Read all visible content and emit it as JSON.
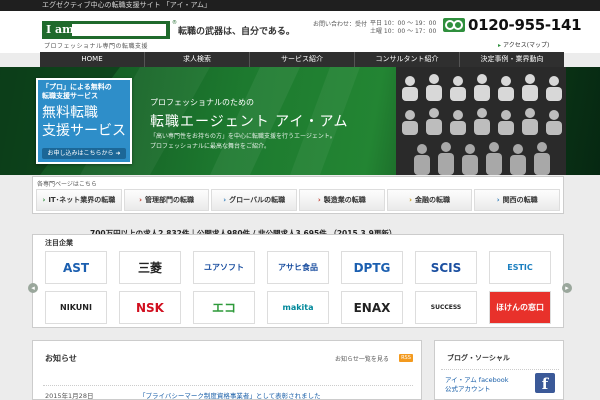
{
  "topbar": {
    "text": "エグゼクティブ中心の転職支援サイト 「アイ・アム」"
  },
  "header": {
    "logo_text": "I am",
    "logo_sub": "プロフェッショナル専門の転職支援",
    "tagline": "転職の武器は、自分である。",
    "contact_label": "お問い合わせ：受付",
    "hours_weekday": "平日 10：00 〜 19：00",
    "hours_saturday": "土曜 10：00 〜 17：00",
    "free_label": "0",
    "phone": "0120-955-141",
    "access": "アクセス(マップ)"
  },
  "nav": [
    "HOME",
    "求人検索",
    "サービス紹介",
    "コンサルタント紹介",
    "決定事例・業界動向"
  ],
  "hero": {
    "subtitle": "プロフェッショナルのための",
    "title": "転職エージェント アイ・アム",
    "desc1": "「高い専門性をお持ちの方」を中心に転職支援を行うエージェント。",
    "desc2": "プロフェッショナルに最高な舞台をご紹介。"
  },
  "promo": {
    "line1": "「プロ」による無料の",
    "line2": "転職支援サービス",
    "big1": "無料転職",
    "big2": "支援サービス",
    "button": "お申し込みはこちらから"
  },
  "specialty": {
    "label": "各専門ページはこちら",
    "tabs": [
      {
        "label": "IT･ネット業界の転職",
        "color": "#2e8b3a"
      },
      {
        "label": "管理部門の転職",
        "color": "#c0392b"
      },
      {
        "label": "グローバルの転職",
        "color": "#2d7ab8"
      },
      {
        "label": "製造業の転職",
        "color": "#c0392b"
      },
      {
        "label": "金融の転職",
        "color": "#c89a1a"
      },
      {
        "label": "関西の転職",
        "color": "#2d7ab8"
      }
    ]
  },
  "stats": "700万円以上の求人2,832件｜公開求人980件 / 非公開求人3,695件 （2015.3.9更新）",
  "companies": {
    "label": "注目企業",
    "logos": [
      {
        "name": "AST",
        "color": "#1b5fb0"
      },
      {
        "name": "三菱",
        "color": "#222222"
      },
      {
        "name": "ユアソフト",
        "color": "#1b4fa0"
      },
      {
        "name": "アサヒ食品",
        "color": "#1b4fa0"
      },
      {
        "name": "DPTG",
        "color": "#1b5fb0"
      },
      {
        "name": "SCIS",
        "color": "#1b4fa0"
      },
      {
        "name": "ESTIC",
        "color": "#1b7fc0"
      },
      {
        "name": "NIKUNI",
        "color": "#222222"
      },
      {
        "name": "NSK",
        "color": "#d10f1f"
      },
      {
        "name": "エコ",
        "color": "#2e9a3a"
      },
      {
        "name": "makita",
        "color": "#00889a"
      },
      {
        "name": "ENAX",
        "color": "#222222"
      },
      {
        "name": "SUCCESS",
        "color": "#222222"
      },
      {
        "name": "ほけんの窓口",
        "color": "#ffffff"
      }
    ]
  },
  "news": {
    "title": "お知らせ",
    "more": "お知らせ一覧を見る",
    "badge": "RSS",
    "date": "2015年1月28日",
    "link": "「プライバシーマーク制度資格事業者」として表彰されました"
  },
  "social": {
    "title": "ブログ・ソーシャル",
    "fb_line1": "アイ・アム facebook",
    "fb_line2": "公式アカウント",
    "fb_icon": "f"
  }
}
